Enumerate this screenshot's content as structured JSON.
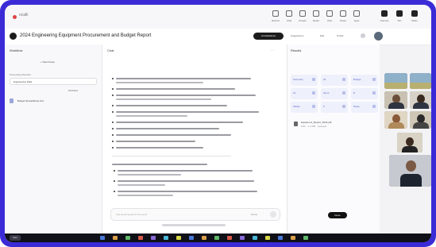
{
  "topbar": {
    "app_name": "ocalli",
    "tools": [
      {
        "label": "Record",
        "icon": "record-icon"
      },
      {
        "label": "Chat",
        "icon": "chat-icon"
      },
      {
        "label": "People",
        "icon": "people-icon"
      },
      {
        "label": "React",
        "icon": "react-icon"
      },
      {
        "label": "View",
        "icon": "view-icon"
      },
      {
        "label": "Notes",
        "icon": "notes-icon"
      },
      {
        "label": "Apps",
        "icon": "apps-icon"
      },
      {
        "label": "Camera",
        "icon": "camera-icon"
      },
      {
        "label": "Mic",
        "icon": "mic-icon"
      },
      {
        "label": "Share",
        "icon": "share-icon"
      }
    ]
  },
  "header": {
    "title": "2024 Engineering Equipment Procurement and Budget Report",
    "primary_button": "AI Assistance",
    "links": [
      "Suggestions",
      "Edit",
      "Profile"
    ]
  },
  "left_panel": {
    "title": "Workflow",
    "add_label": "+ New Group",
    "section_label": "Processing Records",
    "select_value": "Engineering Data",
    "label_right": "Workflow",
    "file_name": "Budget Spreadsheet.xlsx"
  },
  "center": {
    "tab": "Chat",
    "tools": "⋯",
    "input_placeholder": "Ask anything about the report",
    "model_label": "Model",
    "send_icon": "send-icon"
  },
  "right_panel": {
    "title": "Results",
    "cards": [
      "Summary",
      "24",
      "Budget",
      "12",
      "Items",
      "8",
      "Tables",
      "5",
      "Notes",
      "3"
    ],
    "item_title": "Equipment_Report_2024.pdf",
    "item_sub": "PDF · 2.4 MB · Updated",
    "done_button": "Done"
  },
  "taskbar": {
    "start": "Start"
  },
  "colors": {
    "frame": "#3b2bd6",
    "accent": "#5563c9",
    "dark": "#111111"
  }
}
